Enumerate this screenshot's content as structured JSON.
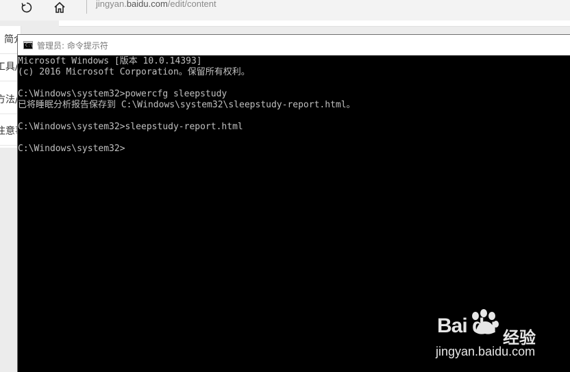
{
  "browser": {
    "url_prefix": "jingyan.",
    "url_host": "baidu.com",
    "url_path": "/edit/content"
  },
  "bg_page": {
    "tabs": [
      {
        "label": "简介"
      },
      {
        "label": "工具/原料"
      },
      {
        "label": "方法/步骤"
      },
      {
        "label": "注意事项"
      }
    ]
  },
  "cmd": {
    "title": "管理员: 命令提示符",
    "icon_text": "C:\\",
    "lines": [
      "Microsoft Windows [版本 10.0.14393]",
      "(c) 2016 Microsoft Corporation。保留所有权利。",
      "",
      "C:\\Windows\\system32>powercfg sleepstudy",
      "已将睡眠分析报告保存到 C:\\Windows\\system32\\sleepstudy-report.html。",
      "",
      "C:\\Windows\\system32>sleepstudy-report.html",
      "",
      "C:\\Windows\\system32>"
    ]
  },
  "watermark": {
    "logo": "Bai du",
    "brand_cn": "经验",
    "url": "jingyan.baidu.com"
  },
  "icons": {
    "reload": "reload-icon",
    "home": "home-icon",
    "cmd": "command-prompt-icon",
    "paw": "baidu-paw-icon"
  },
  "colors": {
    "console_bg": "#000000",
    "console_text": "#c0c0c0",
    "titlebar_bg": "#ffffff"
  }
}
